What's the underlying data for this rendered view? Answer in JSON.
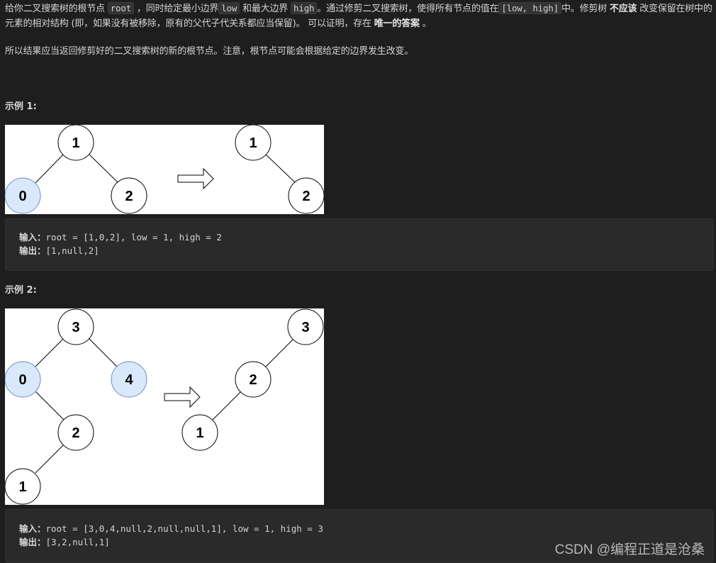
{
  "description": {
    "p1_a": "给你二叉搜索树的根节点 ",
    "code_root": "root",
    "p1_b": " ，同时给定最小边界",
    "code_low": "low",
    "p1_c": " 和最大边界 ",
    "code_high": "high",
    "p1_d": "。通过修剪二叉搜索树，使得所有节点的值在",
    "code_range": "[low, high]",
    "p1_e": "中。修剪树 ",
    "bold_shouldnt": "不应该",
    "p1_f": " 改变保留在树中的元素的相对结构 (即，如果没有被移除，原有的父代子代关系都应当保留)。 可以证明，存在 ",
    "bold_unique": "唯一的答案",
    "p1_g": " 。",
    "p2": "所以结果应当返回修剪好的二叉搜索树的新的根节点。注意，根节点可能会根据给定的边界发生改变。"
  },
  "examples": [
    {
      "heading": "示例 1:",
      "input_label": "输入：",
      "input_value": "root = [1,0,2], low = 1, high = 2",
      "output_label": "输出：",
      "output_value": "[1,null,2]",
      "figure": {
        "before_nodes": [
          "1",
          "0",
          "2"
        ],
        "removed_nodes": [
          "0"
        ],
        "after_nodes": [
          "1",
          "2"
        ],
        "arrow": "right-arrow"
      }
    },
    {
      "heading": "示例 2:",
      "input_label": "输入：",
      "input_value": "root = [3,0,4,null,2,null,null,1], low = 1, high = 3",
      "output_label": "输出：",
      "output_value": "[3,2,null,1]",
      "figure": {
        "before_nodes": [
          "3",
          "0",
          "4",
          "2",
          "1"
        ],
        "removed_nodes": [
          "0",
          "4"
        ],
        "after_nodes": [
          "3",
          "2",
          "1"
        ],
        "arrow": "right-arrow"
      }
    }
  ],
  "colors": {
    "removed_fill": "#dae8fc",
    "removed_stroke": "#6c8ebf",
    "node_stroke": "#000000"
  },
  "watermark": "CSDN @编程正道是沧桑"
}
